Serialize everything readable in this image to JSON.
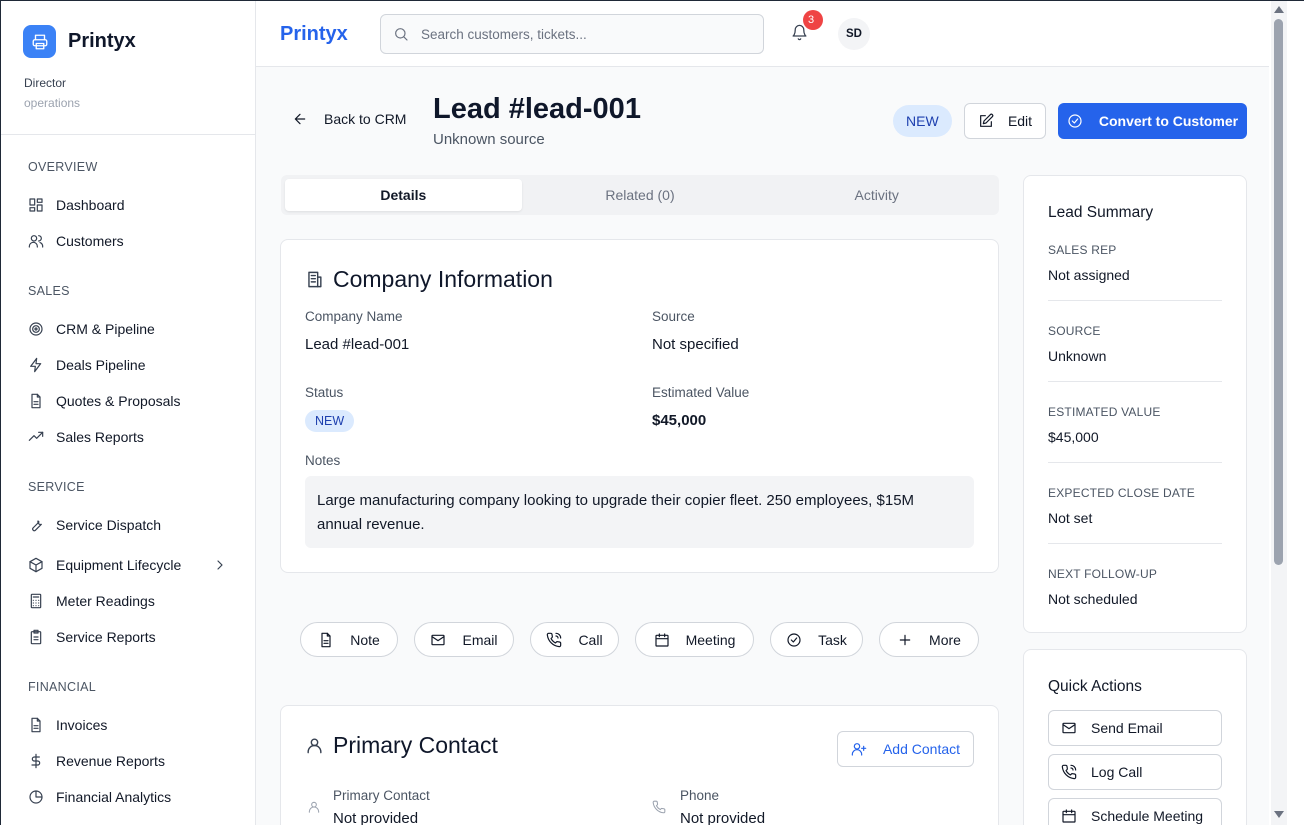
{
  "app": {
    "name": "Printyx",
    "role": "Director",
    "department": "operations"
  },
  "sidebar": {
    "sections": [
      {
        "title": "OVERVIEW",
        "items": [
          {
            "label": "Dashboard",
            "icon": "dashboard-icon"
          },
          {
            "label": "Customers",
            "icon": "users-icon"
          }
        ]
      },
      {
        "title": "SALES",
        "items": [
          {
            "label": "CRM & Pipeline",
            "icon": "target-icon"
          },
          {
            "label": "Deals Pipeline",
            "icon": "zap-icon"
          },
          {
            "label": "Quotes & Proposals",
            "icon": "file-text-icon"
          },
          {
            "label": "Sales Reports",
            "icon": "trending-up-icon"
          }
        ]
      },
      {
        "title": "SERVICE",
        "items": [
          {
            "label": "Service Dispatch",
            "icon": "wrench-icon"
          },
          {
            "label": "Equipment Lifecycle",
            "icon": "box-icon"
          },
          {
            "label": "Meter Readings",
            "icon": "calculator-icon"
          },
          {
            "label": "Service Reports",
            "icon": "clipboard-icon"
          }
        ]
      },
      {
        "title": "FINANCIAL",
        "items": [
          {
            "label": "Invoices",
            "icon": "file-text-icon"
          },
          {
            "label": "Revenue Reports",
            "icon": "dollar-icon"
          },
          {
            "label": "Financial Analytics",
            "icon": "pie-chart-icon"
          }
        ]
      }
    ]
  },
  "topbar": {
    "brand": "Printyx",
    "search_placeholder": "Search customers, tickets...",
    "notification_count": "3",
    "avatar_initials": "SD"
  },
  "header": {
    "back_label": "Back to CRM",
    "title": "Lead #lead-001",
    "subtitle": "Unknown source",
    "status": "NEW",
    "edit_label": "Edit",
    "convert_label": "Convert to Customer"
  },
  "tabs": [
    {
      "label": "Details",
      "active": true
    },
    {
      "label": "Related (0)",
      "active": false
    },
    {
      "label": "Activity",
      "active": false
    }
  ],
  "company": {
    "title": "Company Information",
    "company_name_label": "Company Name",
    "company_name": "Lead #lead-001",
    "source_label": "Source",
    "source": "Not specified",
    "status_label": "Status",
    "status": "NEW",
    "est_value_label": "Estimated Value",
    "est_value": "$45,000",
    "notes_label": "Notes",
    "notes": "Large manufacturing company looking to upgrade their copier fleet. 250 employees, $15M annual revenue."
  },
  "activity_actions": [
    {
      "label": "Note",
      "icon": "note-icon"
    },
    {
      "label": "Email",
      "icon": "mail-icon"
    },
    {
      "label": "Call",
      "icon": "phone-icon"
    },
    {
      "label": "Meeting",
      "icon": "calendar-icon"
    },
    {
      "label": "Task",
      "icon": "check-circle-icon"
    },
    {
      "label": "More",
      "icon": "plus-icon"
    }
  ],
  "contact": {
    "title": "Primary Contact",
    "add_label": "Add Contact",
    "primary_label": "Primary Contact",
    "primary_value": "Not provided",
    "phone_label": "Phone",
    "phone_value": "Not provided"
  },
  "summary": {
    "title": "Lead Summary",
    "rows": [
      {
        "label": "SALES REP",
        "value": "Not assigned"
      },
      {
        "label": "SOURCE",
        "value": "Unknown"
      },
      {
        "label": "ESTIMATED VALUE",
        "value": "$45,000"
      },
      {
        "label": "EXPECTED CLOSE DATE",
        "value": "Not set"
      },
      {
        "label": "NEXT FOLLOW-UP",
        "value": "Not scheduled"
      }
    ]
  },
  "quick_actions": {
    "title": "Quick Actions",
    "items": [
      {
        "label": "Send Email",
        "icon": "mail-icon"
      },
      {
        "label": "Log Call",
        "icon": "phone-icon"
      },
      {
        "label": "Schedule Meeting",
        "icon": "calendar-icon"
      }
    ]
  },
  "colors": {
    "primary": "#2563eb",
    "badge_bg": "#dbeafe",
    "badge_text": "#1e40af",
    "notification": "#ef4444"
  }
}
